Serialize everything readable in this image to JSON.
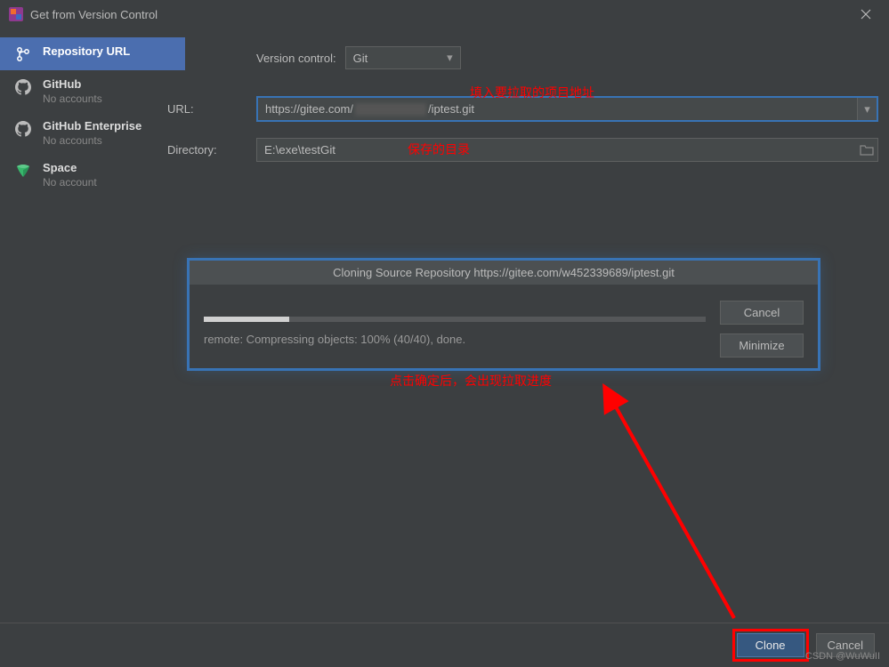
{
  "titlebar": {
    "title": "Get from Version Control"
  },
  "sidebar": {
    "items": [
      {
        "label": "Repository URL",
        "sub": null,
        "icon": "branch"
      },
      {
        "label": "GitHub",
        "sub": "No accounts",
        "icon": "github"
      },
      {
        "label": "GitHub Enterprise",
        "sub": "No accounts",
        "icon": "github"
      },
      {
        "label": "Space",
        "sub": "No account",
        "icon": "space"
      }
    ]
  },
  "form": {
    "version_control_label": "Version control:",
    "version_control_value": "Git",
    "url_label": "URL:",
    "url_prefix": "https://gitee.com/",
    "url_suffix": "/iptest.git",
    "directory_label": "Directory:",
    "directory_value": "E:\\exe\\testGit"
  },
  "annotations": {
    "url": "填入要拉取的项目地址",
    "directory": "保存的目录",
    "progress": "点击确定后，会出现拉取进度"
  },
  "progress": {
    "title": "Cloning Source Repository https://gitee.com/w452339689/iptest.git",
    "status": "remote: Compressing objects: 100% (40/40), done.",
    "cancel_label": "Cancel",
    "minimize_label": "Minimize",
    "percent": 17
  },
  "footer": {
    "clone_label": "Clone",
    "cancel_label": "Cancel"
  },
  "watermark": "CSDN @WuWuII"
}
